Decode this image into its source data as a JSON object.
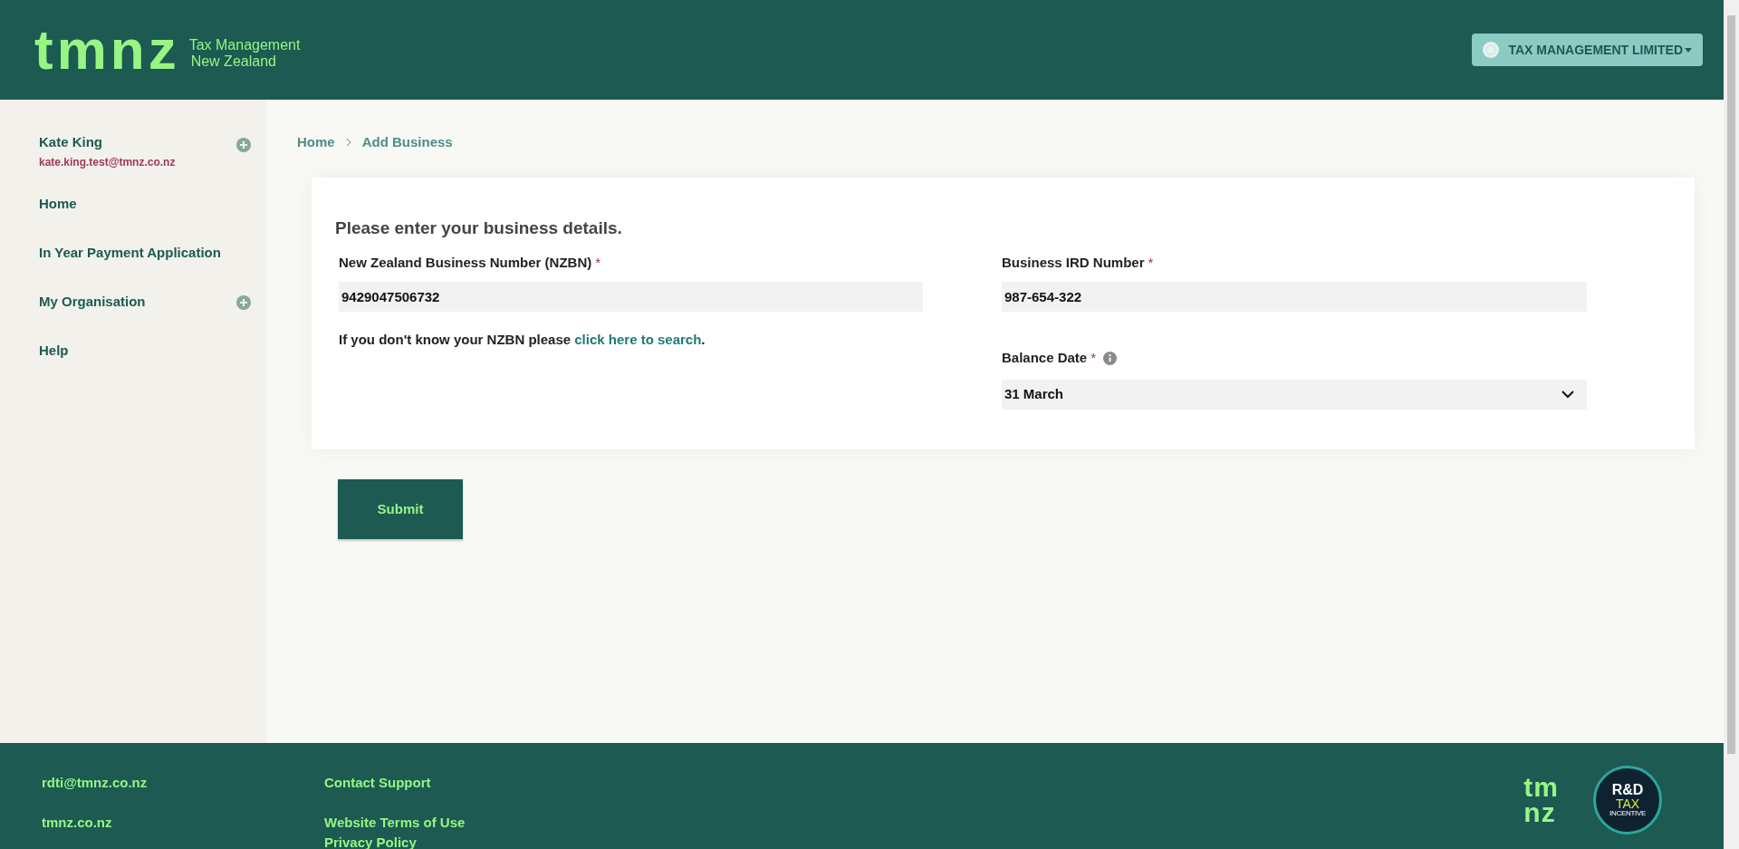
{
  "header": {
    "logo": "tmnz",
    "tagline": [
      "Tax Management",
      "New Zealand"
    ],
    "org_button": "TAX MANAGEMENT LIMITED"
  },
  "sidebar": {
    "user": {
      "name": "Kate King",
      "email": "kate.king.test@tmnz.co.nz",
      "expandable": true
    },
    "items": [
      {
        "label": "Home",
        "expandable": false
      },
      {
        "label": "In Year Payment Application",
        "expandable": false
      },
      {
        "label": "My Organisation",
        "expandable": true
      },
      {
        "label": "Help",
        "expandable": false
      }
    ]
  },
  "breadcrumb": [
    "Home",
    "Add Business"
  ],
  "form": {
    "title": "Please enter your business details.",
    "fields": [
      {
        "kind": "text",
        "label": "New Zealand Business Number (NZBN)",
        "required": true,
        "value": "9429047506732",
        "info": false
      },
      {
        "kind": "text",
        "label": "Business IRD Number",
        "required": true,
        "value": "987-654-322",
        "info": false
      },
      {
        "kind": "select",
        "label": "Balance Date",
        "required": true,
        "value": "31 March",
        "info": true
      }
    ],
    "hint": {
      "text": "If you don't know your NZBN please",
      "link": "click here to search",
      "end": "."
    },
    "required_mark": "*"
  },
  "submit": "Submit",
  "footer": {
    "columns": [
      [
        "rdti@tmnz.co.nz",
        "tmnz.co.nz"
      ],
      [
        "Contact Support",
        "Website Terms of Use",
        "Privacy Policy"
      ]
    ],
    "logo": [
      "tm",
      "nz"
    ],
    "badge": [
      "R&D",
      "TAX",
      "INCENTIVE"
    ]
  }
}
